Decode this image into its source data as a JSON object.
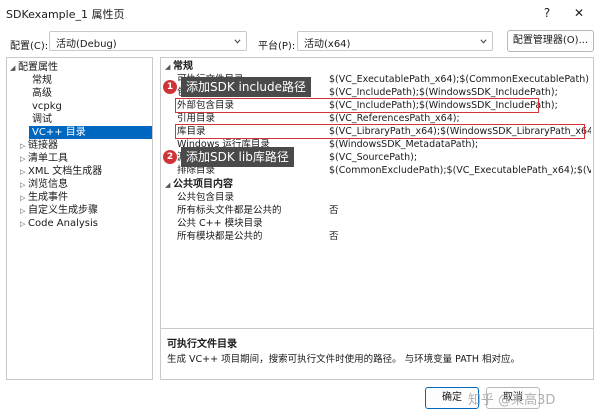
{
  "window": {
    "title": "SDKexample_1 属性页",
    "help": "?",
    "close": "✕"
  },
  "config": {
    "config_label": "配置(C):",
    "config_value": "活动(Debug)",
    "platform_label": "平台(P):",
    "platform_value": "活动(x64)",
    "manager_button": "配置管理器(O)..."
  },
  "tree": {
    "root": "配置属性",
    "items": [
      "常规",
      "高级",
      "vcpkg",
      "调试",
      "VC++ 目录",
      "链接器",
      "清单工具",
      "XML 文档生成器",
      "浏览信息",
      "生成事件",
      "自定义生成步骤",
      "Code Analysis"
    ],
    "selected": "VC++ 目录"
  },
  "grid": {
    "category_general": "常规",
    "rows": [
      {
        "name": "可执行文件目录",
        "value": "$(VC_ExecutablePath_x64);$(CommonExecutablePath)"
      },
      {
        "name": "包含目录",
        "value": "$(VC_IncludePath);$(WindowsSDK_IncludePath);"
      },
      {
        "name": "外部包含目录",
        "value": "$(VC_IncludePath);$(WindowsSDK_IncludePath);"
      },
      {
        "name": "引用目录",
        "value": "$(VC_ReferencesPath_x64);"
      },
      {
        "name": "库目录",
        "value": "$(VC_LibraryPath_x64);$(WindowsSDK_LibraryPath_x64)"
      },
      {
        "name": "Windows 运行库目录",
        "value": "$(WindowsSDK_MetadataPath);"
      },
      {
        "name": "源目录",
        "value": "$(VC_SourcePath);"
      },
      {
        "name": "排除目录",
        "value": "$(CommonExcludePath);$(VC_ExecutablePath_x64);$(VC_Lib"
      }
    ],
    "category_public": "公共项目内容",
    "public_rows": [
      {
        "name": "公共包含目录",
        "value": ""
      },
      {
        "name": "所有标头文件都是公共的",
        "value": "否"
      },
      {
        "name": "公共 C++ 模块目录",
        "value": ""
      },
      {
        "name": "所有模块都是公共的",
        "value": "否"
      }
    ]
  },
  "annotations": {
    "badge1": "1",
    "callout1": "添加SDK include路径",
    "badge2": "2",
    "callout2": "添加SDK lib库路径",
    "highlight_color": "#d13438"
  },
  "description": {
    "heading": "可执行文件目录",
    "text": "生成 VC++ 项目期间，搜索可执行文件时使用的路径。 与环境变量 PATH 相对应。"
  },
  "buttons": {
    "ok": "确定",
    "cancel": "取消"
  },
  "watermark": "知乎 @来高3D"
}
